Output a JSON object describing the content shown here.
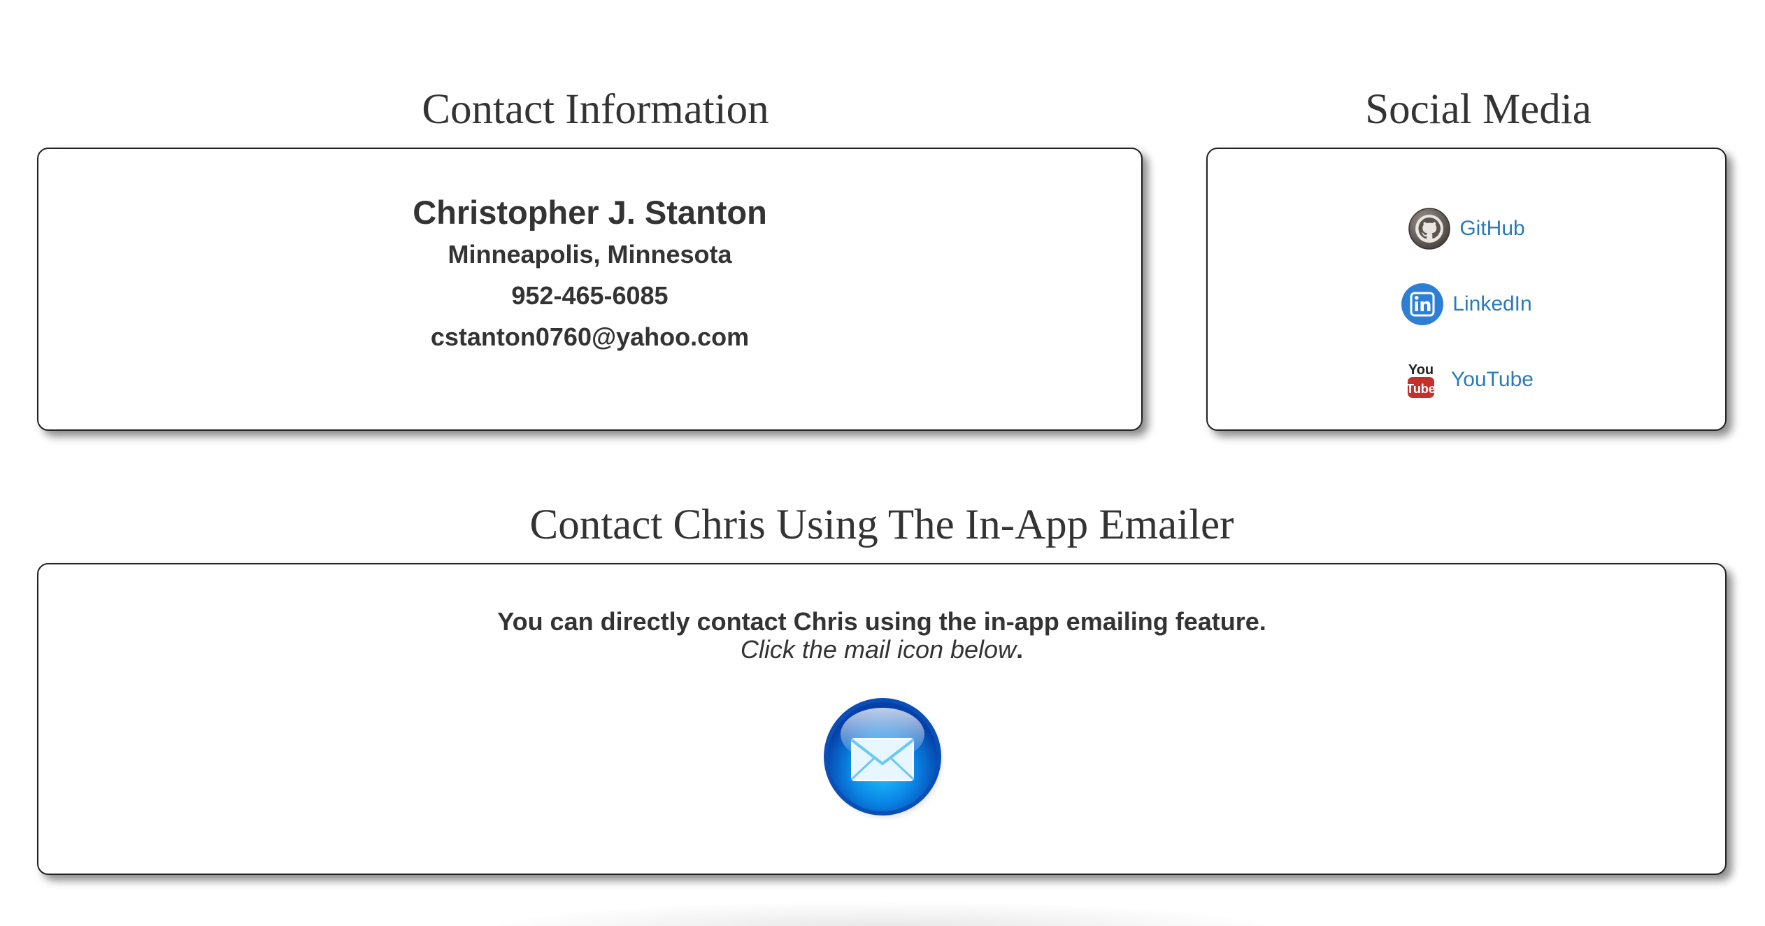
{
  "contact_section": {
    "title": "Contact Information",
    "name": "Christopher J. Stanton",
    "location": "Minneapolis, Minnesota",
    "phone": "952-465-6085",
    "email": "cstanton0760@yahoo.com"
  },
  "social_section": {
    "title": "Social Media",
    "links": [
      {
        "label": "GitHub",
        "icon": "github-icon"
      },
      {
        "label": "LinkedIn",
        "icon": "linkedin-icon"
      },
      {
        "label": "YouTube",
        "icon": "youtube-icon"
      }
    ]
  },
  "emailer_section": {
    "title": "Contact Chris Using The In-App Emailer",
    "description": "You can directly contact Chris using the in-app emailing feature.",
    "instruction": "Click the mail icon below",
    "instruction_period": ".",
    "button_icon": "mail-icon"
  },
  "colors": {
    "link": "#2a7ab8",
    "text": "#333333",
    "border": "#222222",
    "linkedin": "#2d7fd6",
    "youtube_red": "#c4302b",
    "mail_blue": "#0a6fd8"
  }
}
